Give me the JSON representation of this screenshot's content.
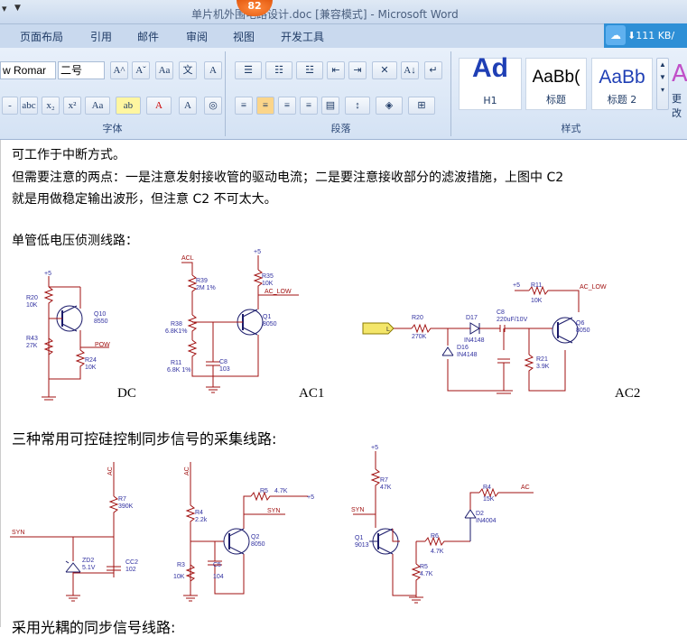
{
  "window": {
    "title": "单片机外围电路设计.doc [兼容模式] - Microsoft Word",
    "badge": "82"
  },
  "tabs": [
    "页面布局",
    "引用",
    "邮件",
    "审阅",
    "视图",
    "开发工具"
  ],
  "net_speed": "111 KB/",
  "ribbon": {
    "font_name": "w Romar",
    "font_size": "二号",
    "font_group": "字体",
    "para_group": "段落",
    "style_group": "样式",
    "styles": [
      {
        "preview": "Ad",
        "name": "H1"
      },
      {
        "preview": "AaBb(",
        "name": "标题"
      },
      {
        "preview": "AaBb",
        "name": "标题 2"
      }
    ],
    "more": "更改"
  },
  "doc": {
    "line1": "可工作于中断方式。",
    "line2": "但需要注意的两点：一是注意发射接收管的驱动电流；二是要注意接收部分的滤波措施，上图中 C2",
    "line3": "就是用做稳定输出波形，但注意 C2 不可太大。",
    "heading1": "单管低电压侦测线路：",
    "cap_dc": "DC",
    "cap_ac1": "AC1",
    "cap_ac2": "AC2",
    "heading2": "三种常用可控硅控制同步信号的采集线路:",
    "heading3": "采用光耦的同步信号线路:"
  },
  "circuit1": {
    "vcc": "+5",
    "r20": "R20",
    "r20v": "10K",
    "q10": "Q10",
    "q10v": "8550",
    "r43": "R43",
    "r43v": "27K",
    "pow": "POW",
    "r24": "R24",
    "r24v": "10K"
  },
  "circuit2": {
    "acl": "ACL",
    "r39": "R39",
    "r39v": "2M 1%",
    "vcc": "+5",
    "r35": "R35",
    "r35v": "10K",
    "aclow": "AC_LOW",
    "r38": "R38",
    "r38v": "6.8K1%",
    "q1": "Q1",
    "q1v": "8050",
    "c8": "C8",
    "c8v": "103",
    "r11": "R11",
    "r11v": "6.8K 1%"
  },
  "circuit3": {
    "l": "L",
    "r20": "R20",
    "r20v": "270K",
    "d17": "D17",
    "d17v": "IN4148",
    "d16": "D16",
    "d16v": "IN4148",
    "c8": "C8",
    "c8v": "220uF/10V",
    "vcc": "+5",
    "r11": "R11",
    "r11v": "10K",
    "aclow": "AC_LOW",
    "q6": "Q6",
    "q6v": "8050",
    "r21": "R21",
    "r21v": "3.9K"
  },
  "circuit4": {
    "ac": "AC",
    "r7": "R7",
    "r7v": "390K",
    "syn": "SYN",
    "zd2": "ZD2",
    "zd2v": "5.1V",
    "cc2": "CC2",
    "cc2v": "102"
  },
  "circuit5": {
    "ac": "AC",
    "r5": "R5",
    "r5v": "4.7K",
    "vcc": "+5",
    "r4": "R4",
    "r4v": "2.2k",
    "syn": "SYN",
    "q2": "Q2",
    "q2v": "8050",
    "r3": "R3",
    "r3v": "10K",
    "c5": "C5",
    "c5v": "104"
  },
  "circuit6": {
    "vcc": "+5",
    "r7": "R7",
    "r7v": "47K",
    "syn": "SYN",
    "q1": "Q1",
    "q1v": "9013",
    "r6": "R6",
    "r6v": "4.7K",
    "r5": "R5",
    "r5v": "4.7K",
    "r4": "R4",
    "r4v": "15K",
    "ac": "AC",
    "d2": "D2",
    "d2v": "IN4004"
  }
}
